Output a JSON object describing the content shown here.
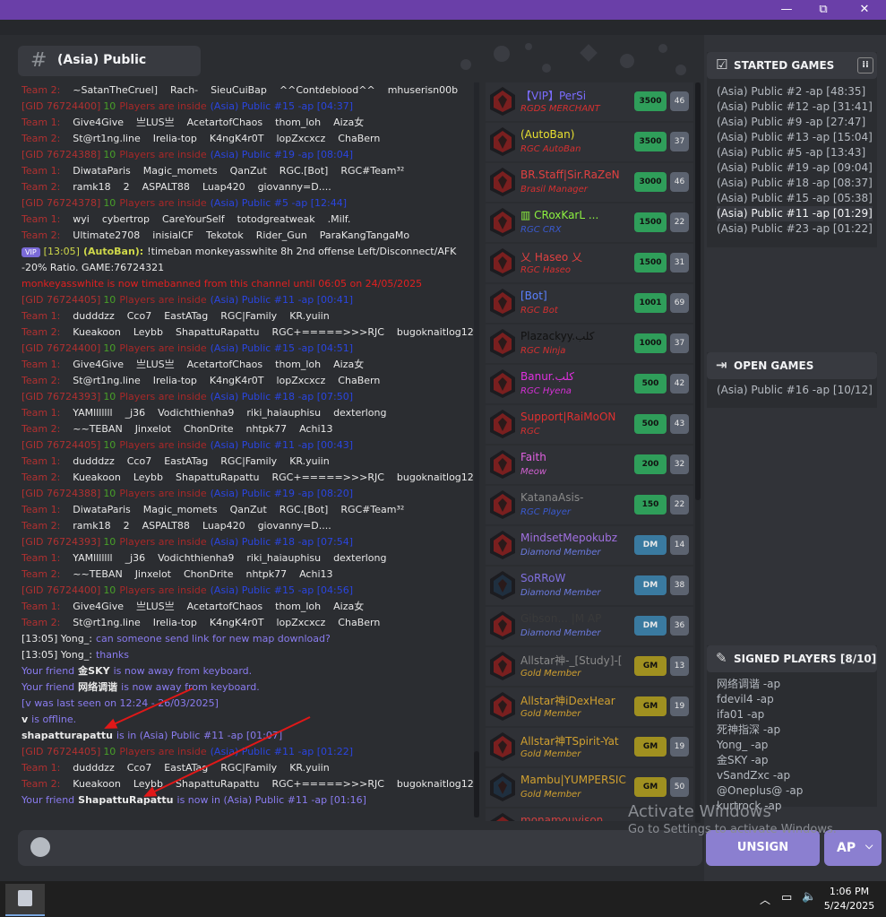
{
  "window": {
    "minimize": "—",
    "restore": "⧉",
    "close": "✕"
  },
  "channel": {
    "title": "(Asia) Public"
  },
  "chat": [
    {
      "k": "team",
      "team": "Team 2:",
      "players": [
        "~SatanTheCruel]",
        "Rach-",
        "SieuCuiBap",
        "^^Contdeblood^^",
        "mhuserisn00b"
      ]
    },
    {
      "k": "gid",
      "gid": "[GID 76724400]",
      "tp": "10",
      "ins": "Players are inside",
      "pub": "(Asia) Public #15 -ap [04:37]"
    },
    {
      "k": "team",
      "team": "Team 1:",
      "players": [
        "Give4Give",
        "亗LUS亗",
        "AcetartofChaos",
        "thom_loh",
        "Aiza女"
      ]
    },
    {
      "k": "team",
      "team": "Team 2:",
      "players": [
        "St@rt1ng.line",
        "Irelia-top",
        "K4ngK4r0T",
        "lopZxcxcz",
        "ChaBern"
      ]
    },
    {
      "k": "gid",
      "gid": "[GID 76724388]",
      "tp": "10",
      "ins": "Players are inside",
      "pub": "(Asia) Public #19 -ap [08:04]"
    },
    {
      "k": "team",
      "team": "Team 1:",
      "players": [
        "DiwataParis",
        "Magic_momets",
        "QanZut",
        "RGC.[Bot]",
        "RGC#Team³²"
      ]
    },
    {
      "k": "team",
      "team": "Team 2:",
      "players": [
        "ramk18",
        "2",
        "ASPALT88",
        "Luap420",
        "giovanny=D...."
      ]
    },
    {
      "k": "gid",
      "gid": "[GID 76724378]",
      "tp": "10",
      "ins": "Players are inside",
      "pub": "(Asia) Public #5 -ap [12:44]"
    },
    {
      "k": "team",
      "team": "Team 1:",
      "players": [
        "wyi",
        "cybertrop",
        "CareYourSelf",
        "totodgreatweak",
        ".Milf."
      ]
    },
    {
      "k": "team",
      "team": "Team 2:",
      "players": [
        "Ultimate2708",
        "inisialCF",
        "Tekotok",
        "Rider_Gun",
        "ParaKangTangaMo"
      ]
    },
    {
      "k": "vip",
      "badge": "VIP",
      "time": "[13:05]",
      "who": "(AutoBan):",
      "msg": "!timeban monkeyasswhite 8h 2nd offense Left/Disconnect/AFK"
    },
    {
      "k": "plain",
      "cls": "pl",
      "text": "-20% Ratio. GAME:76724321"
    },
    {
      "k": "plain",
      "cls": "sys",
      "text": "monkeyasswhite is now timebanned from this channel until 06:05 on 24/05/2025"
    },
    {
      "k": "gid",
      "gid": "[GID 76724405]",
      "tp": "10",
      "ins": "Players are inside",
      "pub": "(Asia) Public #11 -ap [00:41]"
    },
    {
      "k": "team",
      "team": "Team 1:",
      "players": [
        "dudddzz",
        "Cco7",
        "EastATag",
        "RGC|Family",
        "KR.yuiin"
      ]
    },
    {
      "k": "team",
      "team": "Team 2:",
      "players": [
        "Kueakoon",
        "Leybb",
        "ShapattuRapattu",
        "RGC+=====>>>RJC",
        "bugoknaitlog123"
      ]
    },
    {
      "k": "gid",
      "gid": "[GID 76724400]",
      "tp": "10",
      "ins": "Players are inside",
      "pub": "(Asia) Public #15 -ap [04:51]"
    },
    {
      "k": "team",
      "team": "Team 1:",
      "players": [
        "Give4Give",
        "亗LUS亗",
        "AcetartofChaos",
        "thom_loh",
        "Aiza女"
      ]
    },
    {
      "k": "team",
      "team": "Team 2:",
      "players": [
        "St@rt1ng.line",
        "Irelia-top",
        "K4ngK4r0T",
        "lopZxcxcz",
        "ChaBern"
      ]
    },
    {
      "k": "gid",
      "gid": "[GID 76724393]",
      "tp": "10",
      "ins": "Players are inside",
      "pub": "(Asia) Public #18 -ap [07:50]"
    },
    {
      "k": "team",
      "team": "Team 1:",
      "players": [
        "YAMlllllll",
        "_j36",
        "Vodichthienha9",
        "riki_haiauphisu",
        "dexterlong"
      ]
    },
    {
      "k": "team",
      "team": "Team 2:",
      "players": [
        "~~TEBAN",
        "Jinxelot",
        "ChonDrite",
        "nhtpk77",
        "Achi13"
      ]
    },
    {
      "k": "gid",
      "gid": "[GID 76724405]",
      "tp": "10",
      "ins": "Players are inside",
      "pub": "(Asia) Public #11 -ap [00:43]"
    },
    {
      "k": "team",
      "team": "Team 1:",
      "players": [
        "dudddzz",
        "Cco7",
        "EastATag",
        "RGC|Family",
        "KR.yuiin"
      ]
    },
    {
      "k": "team",
      "team": "Team 2:",
      "players": [
        "Kueakoon",
        "Leybb",
        "ShapattuRapattu",
        "RGC+=====>>>RJC",
        "bugoknaitlog123"
      ]
    },
    {
      "k": "gid",
      "gid": "[GID 76724388]",
      "tp": "10",
      "ins": "Players are inside",
      "pub": "(Asia) Public #19 -ap [08:20]"
    },
    {
      "k": "team",
      "team": "Team 1:",
      "players": [
        "DiwataParis",
        "Magic_momets",
        "QanZut",
        "RGC.[Bot]",
        "RGC#Team³²"
      ]
    },
    {
      "k": "team",
      "team": "Team 2:",
      "players": [
        "ramk18",
        "2",
        "ASPALT88",
        "Luap420",
        "giovanny=D...."
      ]
    },
    {
      "k": "gid",
      "gid": "[GID 76724393]",
      "tp": "10",
      "ins": "Players are inside",
      "pub": "(Asia) Public #18 -ap [07:54]"
    },
    {
      "k": "team",
      "team": "Team 1:",
      "players": [
        "YAMlllllll",
        "_j36",
        "Vodichthienha9",
        "riki_haiauphisu",
        "dexterlong"
      ]
    },
    {
      "k": "team",
      "team": "Team 2:",
      "players": [
        "~~TEBAN",
        "Jinxelot",
        "ChonDrite",
        "nhtpk77",
        "Achi13"
      ]
    },
    {
      "k": "gid",
      "gid": "[GID 76724400]",
      "tp": "10",
      "ins": "Players are inside",
      "pub": "(Asia) Public #15 -ap [04:56]"
    },
    {
      "k": "team",
      "team": "Team 1:",
      "players": [
        "Give4Give",
        "亗LUS亗",
        "AcetartofChaos",
        "thom_loh",
        "Aiza女"
      ]
    },
    {
      "k": "team",
      "team": "Team 2:",
      "players": [
        "St@rt1ng.line",
        "Irelia-top",
        "K4ngK4r0T",
        "lopZxcxcz",
        "ChaBern"
      ]
    },
    {
      "k": "msg",
      "who": "[13:05] Yong_:",
      "text": "can someone send link for new map download?"
    },
    {
      "k": "msg",
      "who": "[13:05] Yong_:",
      "text": "thanks"
    },
    {
      "k": "friend",
      "pre": "Your friend",
      "name": "金SKY",
      "post": "is now away from keyboard."
    },
    {
      "k": "friend",
      "pre": "Your friend",
      "name": "网络调谐",
      "post": "is now away from keyboard."
    },
    {
      "k": "plain",
      "cls": "friend",
      "text": "[v was last seen on 12:24 - 26/03/2025]"
    },
    {
      "k": "friend",
      "pre": "",
      "name": "v",
      "post": "is offline."
    },
    {
      "k": "friend",
      "pre": "",
      "name": "shapatturapattu",
      "post": "is in (Asia) Public #11 -ap [01:07]"
    },
    {
      "k": "gid",
      "gid": "[GID 76724405]",
      "tp": "10",
      "ins": "Players are inside",
      "pub": "(Asia) Public #11 -ap [01:22]"
    },
    {
      "k": "team",
      "team": "Team 1:",
      "players": [
        "dudddzz",
        "Cco7",
        "EastATag",
        "RGC|Family",
        "KR.yuiin"
      ]
    },
    {
      "k": "team",
      "team": "Team 2:",
      "players": [
        "Kueakoon",
        "Leybb",
        "ShapattuRapattu",
        "RGC+=====>>>RJC",
        "bugoknaitlog123"
      ]
    },
    {
      "k": "friend",
      "pre": "Your friend",
      "name": "ShapattuRapattu",
      "post": "is now in (Asia) Public #11 -ap [01:16]"
    }
  ],
  "players": [
    {
      "name": "【VIP】PerSi",
      "nc": "#7a6cff",
      "role": "RGDS MERCHANT",
      "rc": "#d63030",
      "elo": "3500",
      "ec": "#2f9e5a",
      "num": "46",
      "av": "#7a1f1f"
    },
    {
      "name": "(AutoBan)",
      "nc": "#e8e030",
      "role": "RGC AutoBan",
      "rc": "#d63030",
      "elo": "3500",
      "ec": "#2f9e5a",
      "num": "37",
      "av": "#7a1f1f"
    },
    {
      "name": "BR.Staff|Sir.RaZeN",
      "nc": "#e04040",
      "role": "Brasil Manager",
      "rc": "#d63030",
      "elo": "3000",
      "ec": "#2f9e5a",
      "num": "46",
      "av": "#7a1f1f"
    },
    {
      "name": "▥ CRoxKarL ...",
      "nc": "#8cf040",
      "role": "RGC CRX",
      "rc": "#3a5ad0",
      "elo": "1500",
      "ec": "#2f9e5a",
      "num": "22",
      "av": "#7a1f1f"
    },
    {
      "name": "乂 Haseo 乂",
      "nc": "#e04040",
      "role": "RGC Haseo",
      "rc": "#d63030",
      "elo": "1500",
      "ec": "#2f9e5a",
      "num": "31",
      "av": "#7a1f1f"
    },
    {
      "name": "[Bot]",
      "nc": "#5a80ff",
      "role": "RGC Bot",
      "rc": "#d63030",
      "elo": "1001",
      "ec": "#2f9e5a",
      "num": "69",
      "av": "#7a1f1f"
    },
    {
      "name": "Plazackyy.كلب",
      "nc": "#111111",
      "role": "RGC Ninja",
      "rc": "#d63030",
      "elo": "1000",
      "ec": "#2f9e5a",
      "num": "37",
      "av": "#7a1f1f"
    },
    {
      "name": "Banur.كلب",
      "nc": "#e030e0",
      "role": "RGC Hyena",
      "rc": "#d630d6",
      "elo": "500",
      "ec": "#2f9e5a",
      "num": "42",
      "av": "#7a1f1f"
    },
    {
      "name": "Support|RaiMoON",
      "nc": "#e03030",
      "role": "RGC",
      "rc": "#d63030",
      "elo": "500",
      "ec": "#2f9e5a",
      "num": "43",
      "av": "#7a1f1f"
    },
    {
      "name": "Faith",
      "nc": "#e060e0",
      "role": "Meow",
      "rc": "#d060d0",
      "elo": "200",
      "ec": "#2f9e5a",
      "num": "32",
      "av": "#7a1f1f"
    },
    {
      "name": "KatanaAsis-",
      "nc": "#8a8a8a",
      "role": "RGC Player",
      "rc": "#3a5ad0",
      "elo": "150",
      "ec": "#2f9e5a",
      "num": "22",
      "av": "#7a1f1f"
    },
    {
      "name": "MindsetMepokubz",
      "nc": "#a070e0",
      "role": "Diamond Member",
      "rc": "#6a7adf",
      "elo": "DM",
      "ec": "#3a7aa0",
      "num": "14",
      "av": "#7a1f1f"
    },
    {
      "name": "SoRRoW",
      "nc": "#8070e0",
      "role": "Diamond Member",
      "rc": "#6a7adf",
      "elo": "DM",
      "ec": "#3a7aa0",
      "num": "38",
      "av": "#1f2f3f"
    },
    {
      "name": "Gibson... |M AP",
      "nc": "#3a3a3a",
      "role": "Diamond Member",
      "rc": "#6a7adf",
      "elo": "DM",
      "ec": "#3a7aa0",
      "num": "36",
      "av": "#7a1f1f"
    },
    {
      "name": "Allstar神-_[Study]-[",
      "nc": "#8a8a8a",
      "role": "Gold Member",
      "rc": "#d0a030",
      "elo": "GM",
      "ec": "#a09020",
      "num": "13",
      "av": "#7a1f1f"
    },
    {
      "name": "Allstar神iDexHear",
      "nc": "#d0a030",
      "role": "Gold Member",
      "rc": "#d0a030",
      "elo": "GM",
      "ec": "#a09020",
      "num": "19",
      "av": "#7a1f1f"
    },
    {
      "name": "Allstar神TSpirit-Yat",
      "nc": "#d0a030",
      "role": "Gold Member",
      "rc": "#d0a030",
      "elo": "GM",
      "ec": "#a09020",
      "num": "19",
      "av": "#7a1f1f"
    },
    {
      "name": "Mambu|YUMPERSIC",
      "nc": "#d0a030",
      "role": "Gold Member",
      "rc": "#d0a030",
      "elo": "GM",
      "ec": "#a09020",
      "num": "50",
      "av": "#1f2f3f"
    },
    {
      "name": "monamouvison",
      "nc": "#d04040",
      "role": "",
      "rc": "#d0a030",
      "elo": "",
      "ec": "#a09020",
      "num": "",
      "av": "#7a1f1f"
    }
  ],
  "started": {
    "title": "STARTED GAMES",
    "items": [
      "(Asia) Public #2 -ap [48:35]",
      "(Asia) Public #12 -ap [31:41]",
      "(Asia) Public #9 -ap [27:47]",
      "(Asia) Public #13 -ap [15:04]",
      "(Asia) Public #5 -ap [13:43]",
      "(Asia) Public #19 -ap [09:04]",
      "(Asia) Public #18 -ap [08:37]",
      "(Asia) Public #15 -ap [05:38]",
      "(Asia) Public #11 -ap [01:29]",
      "(Asia) Public #23 -ap [01:22]"
    ]
  },
  "open": {
    "title": "OPEN GAMES",
    "items": [
      "(Asia) Public #16 -ap [10/12]"
    ]
  },
  "signed": {
    "title": "SIGNED PLAYERS [8/10]",
    "items": [
      "网络调谐 -ap",
      "fdevil4 -ap",
      "ifa01 -ap",
      "死神指深 -ap",
      "Yong_ -ap",
      "金SKY -ap",
      "vSandZxc -ap",
      "@Oneplus@ -ap",
      "kurtrock -ap"
    ]
  },
  "buttons": {
    "unsign": "UNSIGN",
    "ap": "AP"
  },
  "watermark": {
    "title": "Activate Windows",
    "sub": "Go to Settings to activate Windows."
  },
  "taskbar": {
    "time": "1:06 PM",
    "date": "5/24/2025"
  }
}
